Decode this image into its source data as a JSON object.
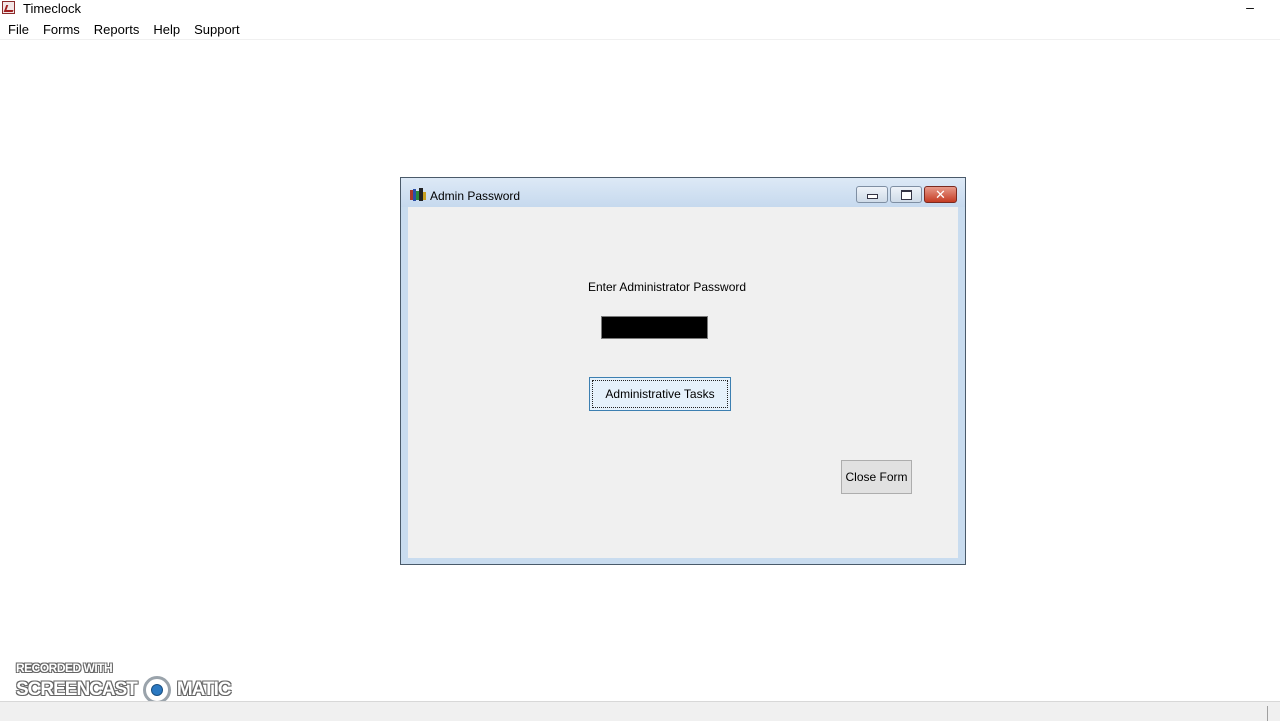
{
  "app": {
    "title": "Timeclock",
    "minimize_glyph": "–"
  },
  "menubar": {
    "items": [
      {
        "label": "File"
      },
      {
        "label": "Forms"
      },
      {
        "label": "Reports"
      },
      {
        "label": "Help"
      },
      {
        "label": "Support"
      }
    ]
  },
  "dialog": {
    "title": "Admin Password",
    "close_glyph": "✕",
    "prompt": "Enter Administrator Password",
    "password_value": "",
    "primary_button": "Administrative Tasks",
    "close_button": "Close Form"
  },
  "watermark": {
    "line1": "RECORDED WITH",
    "left": "SCREENCAST",
    "right": "MATIC"
  },
  "colors": {
    "dialog_frame": "#c9dcef",
    "close_button_red": "#c53c24",
    "focus_blue": "#3c7fb1"
  }
}
